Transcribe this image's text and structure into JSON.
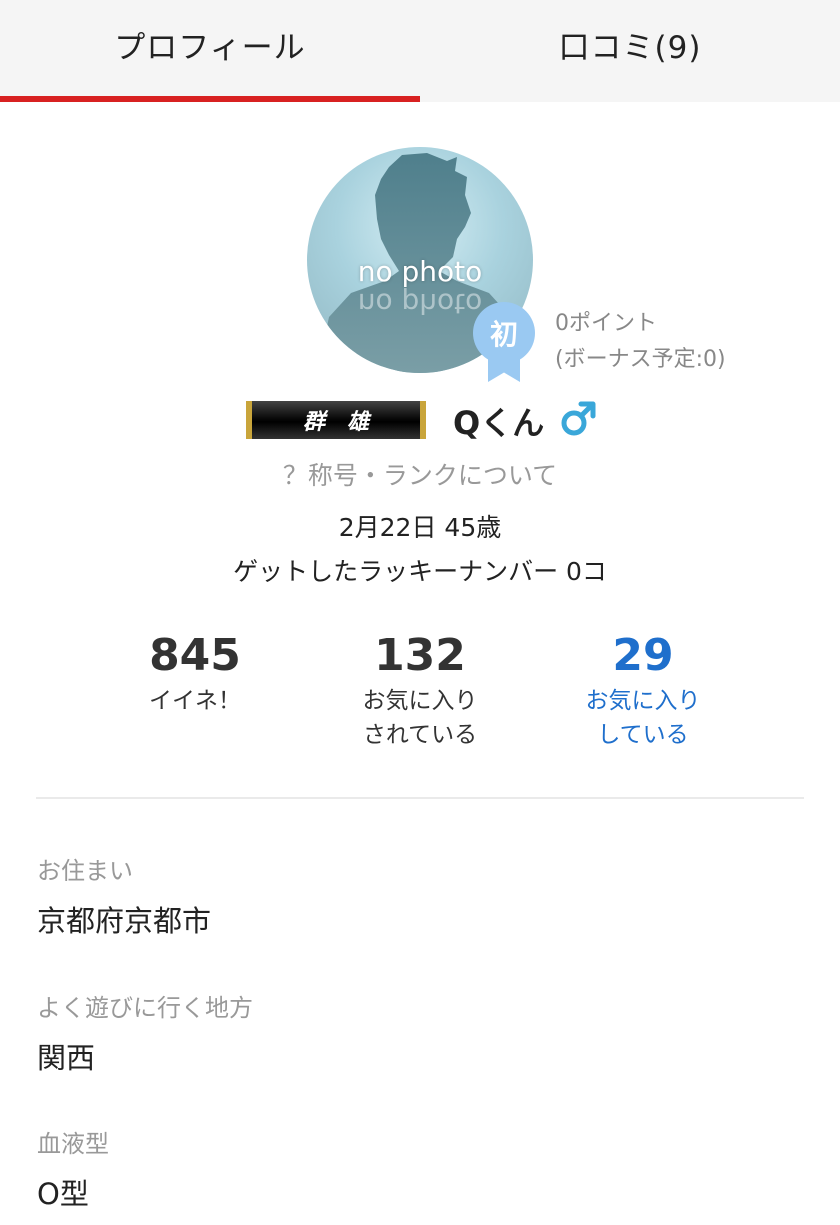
{
  "tabs": [
    {
      "label": "プロフィール",
      "active": true
    },
    {
      "label": "口コミ(9)",
      "active": false
    }
  ],
  "avatar": {
    "text": "no photo"
  },
  "badge": {
    "label": "初"
  },
  "points": {
    "line1": "0ポイント",
    "line2": "(ボーナス予定:0)"
  },
  "rank_title": "群雄",
  "username": "Qくん",
  "gender_symbol": "♂",
  "rank_link": "？称号・ランクについて",
  "birth_age": "2月22日 45歳",
  "lucky_numbers": "ゲットしたラッキーナンバー 0コ",
  "stats": [
    {
      "value": "845",
      "label": "イイネ！"
    },
    {
      "value": "132",
      "label": "お気に入り\nされている"
    },
    {
      "value": "29",
      "label": "お気に入り\nしている"
    }
  ],
  "profile_fields": [
    {
      "key": "お住まい",
      "value": "京都府京都市"
    },
    {
      "key": "よく遊びに行く地方",
      "value": "関西"
    },
    {
      "key": "血液型",
      "value": "O型"
    }
  ],
  "colors": {
    "accent": "#d82121",
    "link_blue": "#1f6fcc",
    "badge_blue": "#9ac9f2",
    "gender_blue": "#3aa7d9"
  }
}
